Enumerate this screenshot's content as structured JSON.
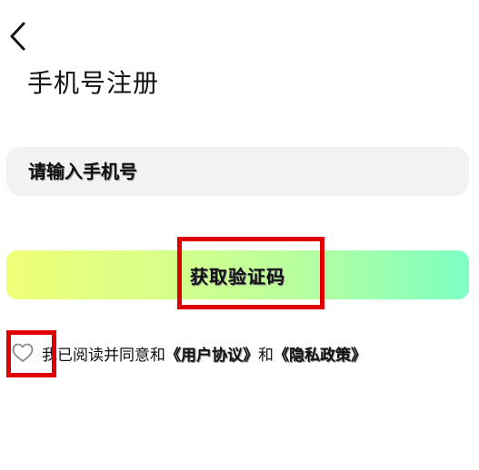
{
  "header": {
    "back_icon": "chevron-left-icon",
    "title": "手机号注册"
  },
  "form": {
    "phone_placeholder": "请输入手机号",
    "phone_value": "",
    "get_code_label": "获取验证码",
    "button_gradient": [
      "#f0ff78",
      "#7dffc4"
    ]
  },
  "agreement": {
    "checkbox_icon": "heart-outline-icon",
    "checked": false,
    "prefix": "我已阅读并同意和",
    "user_agreement": "《用户协议》",
    "conjunction": "和",
    "privacy_policy": "《隐私政策》"
  },
  "annotations": {
    "highlight_color": "#e00000"
  }
}
